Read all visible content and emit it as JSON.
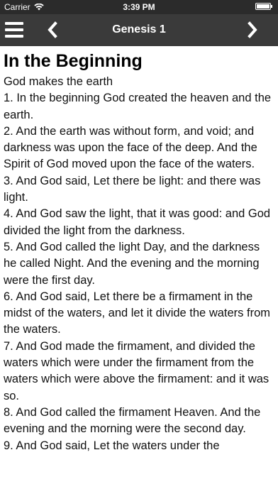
{
  "status_bar": {
    "carrier": "Carrier",
    "time": "3:39 PM",
    "wifi_icon": "wifi-icon",
    "battery_icon": "battery-full-icon"
  },
  "nav": {
    "menu_icon": "hamburger-menu-icon",
    "back_icon": "chevron-left-icon",
    "forward_icon": "chevron-right-icon",
    "title": "Genesis 1",
    "background_color": "#3a3a3a"
  },
  "chapter": {
    "heading": "In the Beginning",
    "subheading": "God makes the earth",
    "verses": [
      "1. In the beginning God created the heaven and the earth.",
      "2. And the earth was without form, and void; and darkness was upon the face of the deep. And the Spirit of God moved upon the face of the waters.",
      "3. And God said, Let there be light: and there was light.",
      "4. And God saw the light, that it was good: and God divided the light from the darkness.",
      "5. And God called the light Day, and the darkness he called Night. And the evening and the morning were the first day.",
      "6. And God said, Let there be a firmament in the midst of the waters, and let it divide the waters from the waters.",
      "7. And God made the firmament, and divided the waters which were under the firmament from the waters which were above the firmament: and it was so.",
      "8. And God called the firmament Heaven. And the evening and the morning were the second day.",
      "9. And God said, Let the waters under the"
    ]
  }
}
